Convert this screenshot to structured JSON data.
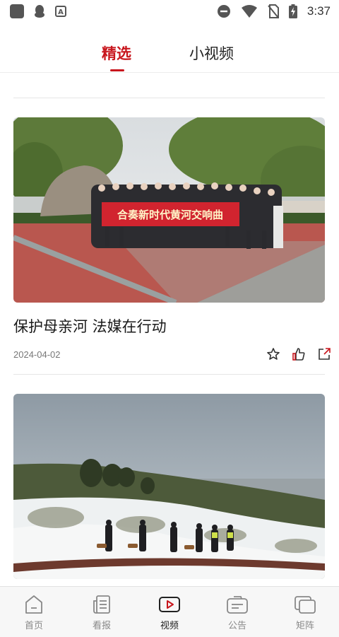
{
  "status_bar": {
    "time": "3:37",
    "left_icons": [
      "app-icon",
      "qq-penguin-icon",
      "a-badge-icon"
    ],
    "right_icons": [
      "do-not-disturb-icon",
      "wifi-icon",
      "no-sim-icon",
      "battery-charging-icon"
    ]
  },
  "top_tabs": [
    {
      "label": "精选",
      "active": true
    },
    {
      "label": "小视频",
      "active": false
    }
  ],
  "feed": {
    "items": [
      {
        "title": "保护母亲河 法媒在行动",
        "date": "2024-04-02",
        "banner_text": "合奏新时代黄河交响曲",
        "actions": [
          "star-icon",
          "thumbs-up-icon",
          "share-icon"
        ]
      },
      {
        "title": "",
        "date": ""
      }
    ]
  },
  "bottom_nav": [
    {
      "label": "首页",
      "icon": "home-icon",
      "active": false
    },
    {
      "label": "看报",
      "icon": "newspaper-icon",
      "active": false
    },
    {
      "label": "视频",
      "icon": "video-play-icon",
      "active": true
    },
    {
      "label": "公告",
      "icon": "announcement-icon",
      "active": false
    },
    {
      "label": "矩阵",
      "icon": "matrix-icon",
      "active": false
    }
  ],
  "colors": {
    "accent": "#c8161d",
    "nav_inactive": "#888888",
    "divider": "#e6e6e6"
  }
}
